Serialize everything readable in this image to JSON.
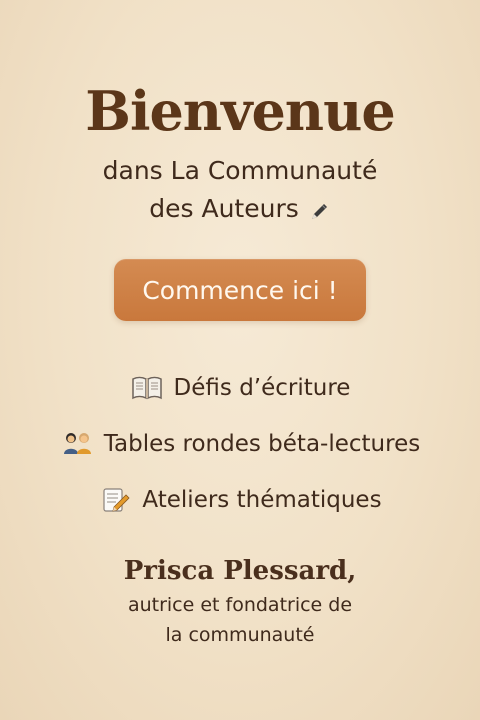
{
  "hero": {
    "title": "Bienvenue",
    "subtitle_line1": "dans La Communauté",
    "subtitle_line2": "des Auteurs",
    "subtitle_icon": "pen-icon"
  },
  "cta": {
    "label": "Commence ici !"
  },
  "features": [
    {
      "icon": "book-icon",
      "label": "Défis d’écriture"
    },
    {
      "icon": "people-icon",
      "label": "Tables rondes béta-lectures"
    },
    {
      "icon": "memo-icon",
      "label": "Ateliers thématiques"
    }
  ],
  "author": {
    "name": "Prisca Plessard,",
    "role_line1": "autrice et fondatrice de",
    "role_line2": "la communauté"
  },
  "colors": {
    "background": "#f2e4cc",
    "title": "#5b3619",
    "button": "#c9783c",
    "button_text": "#fff8ef",
    "text": "#3f2a1c"
  }
}
